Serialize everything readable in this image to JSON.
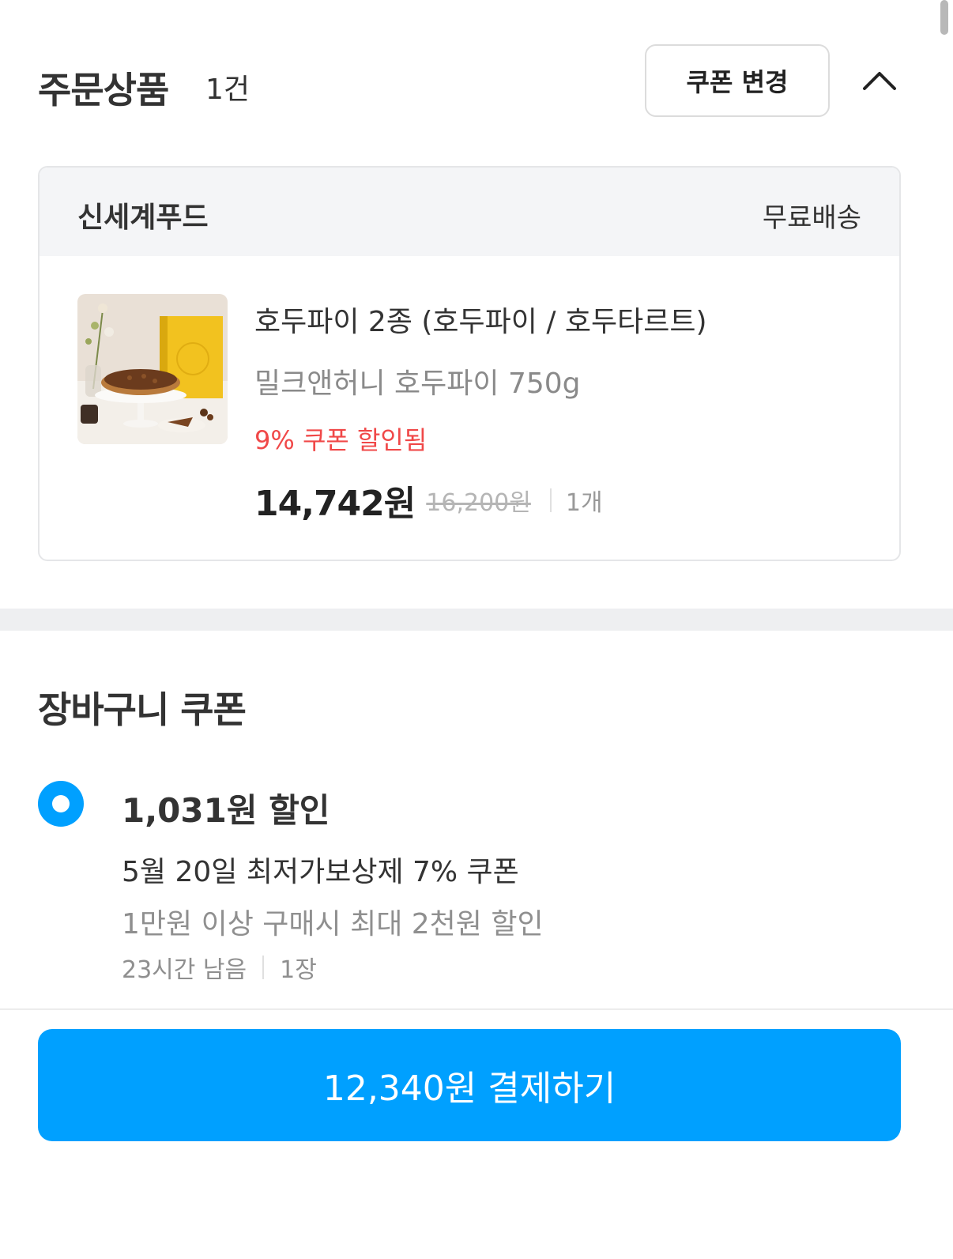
{
  "order": {
    "title": "주문상품",
    "count": "1건",
    "coupon_change_label": "쿠폰 변경",
    "collapse_icon": "chevron-up-icon"
  },
  "seller": {
    "name": "신세계푸드",
    "shipping": "무료배송"
  },
  "product": {
    "name": "호두파이 2종 (호두파이 / 호두타르트)",
    "option": "밀크앤허니 호두파이 750g",
    "discount_note": "9% 쿠폰 할인됨",
    "price": "14,742원",
    "original_price": "16,200원",
    "quantity": "1개",
    "image_icon": "product-photo-walnut-pie"
  },
  "cart_coupon": {
    "title": "장바구니 쿠폰",
    "amount": "1,031원 할인",
    "name": "5월 20일 최저가보상제 7% 쿠폰",
    "condition": "1만원 이상 구매시 최대 2천원 할인",
    "remaining": "23시간 남음",
    "count": "1장",
    "selected": true
  },
  "payment": {
    "button_label": "12,340원 결제하기"
  },
  "colors": {
    "accent": "#00a0ff",
    "discount_red": "#f04848",
    "band_gray": "#eeeff1"
  }
}
